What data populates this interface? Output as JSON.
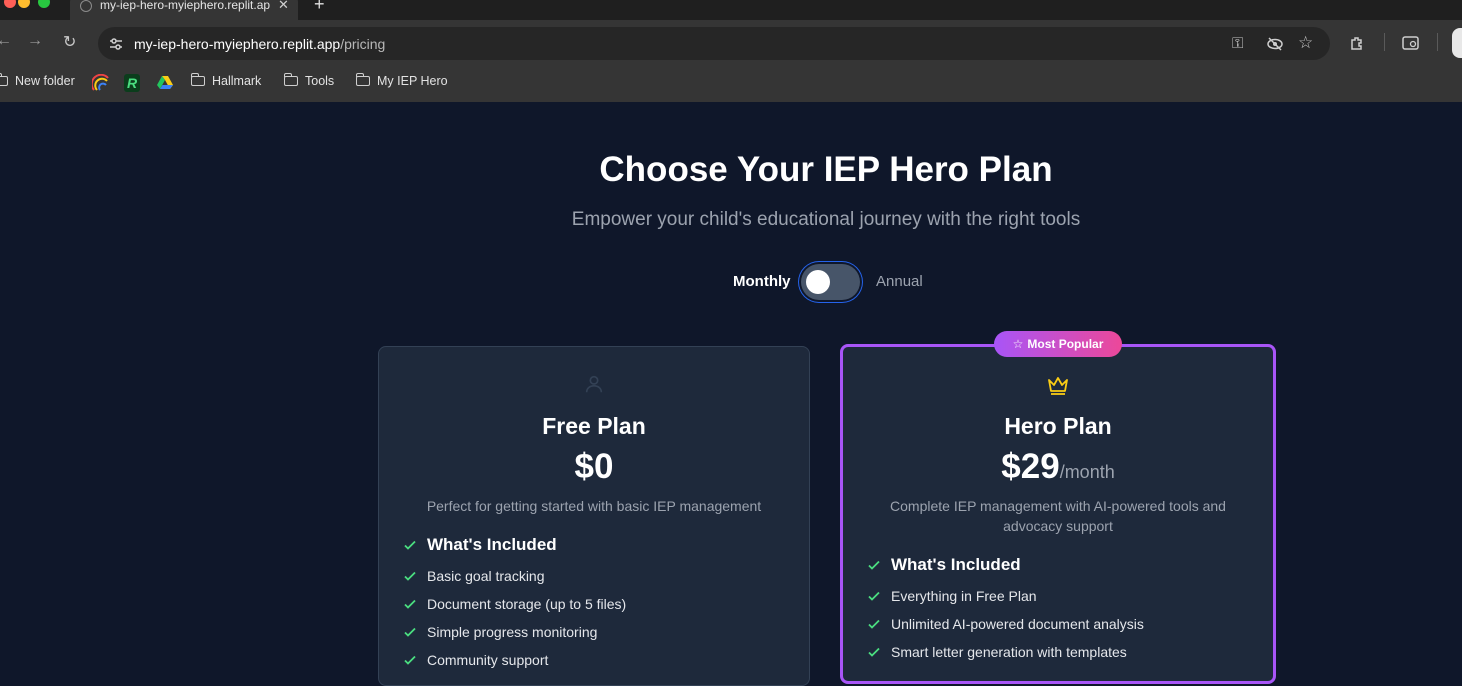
{
  "browser": {
    "tab_title": "my-iep-hero-myiephero.replit.app",
    "url_host": "my-iep-hero-myiephero.replit.app",
    "url_path": "/pricing",
    "bookmarks": [
      {
        "label": "New folder",
        "icon": "folder-icon"
      },
      {
        "label": "",
        "icon": "rainbow-favicon"
      },
      {
        "label": "",
        "icon": "r-favicon"
      },
      {
        "label": "",
        "icon": "google-drive-icon"
      },
      {
        "label": "Hallmark",
        "icon": "folder-icon"
      },
      {
        "label": "Tools",
        "icon": "folder-icon"
      },
      {
        "label": "My IEP Hero",
        "icon": "folder-icon"
      }
    ]
  },
  "page": {
    "title": "Choose Your IEP Hero Plan",
    "subtitle": "Empower your child's educational journey with the right tools",
    "billing": {
      "monthly_label": "Monthly",
      "annual_label": "Annual",
      "selected": "Monthly"
    }
  },
  "plans": {
    "free": {
      "icon": "user-icon",
      "name": "Free Plan",
      "price": "$0",
      "description": "Perfect for getting started with basic IEP management",
      "included_heading": "What's Included",
      "features": [
        "Basic goal tracking",
        "Document storage (up to 5 files)",
        "Simple progress monitoring",
        "Community support"
      ]
    },
    "hero": {
      "badge": "Most Popular",
      "icon": "crown-icon",
      "name": "Hero Plan",
      "price": "$29",
      "period": "/month",
      "description": "Complete IEP management with AI-powered tools and advocacy support",
      "included_heading": "What's Included",
      "features": [
        "Everything in Free Plan",
        "Unlimited AI-powered document analysis",
        "Smart letter generation with templates"
      ]
    }
  },
  "colors": {
    "page_bg": "#0f172a",
    "card_bg": "#1e293b",
    "accent_purple": "#a855f7",
    "accent_pink": "#ec4899",
    "check_green": "#4ade80",
    "crown_yellow": "#facc15"
  }
}
